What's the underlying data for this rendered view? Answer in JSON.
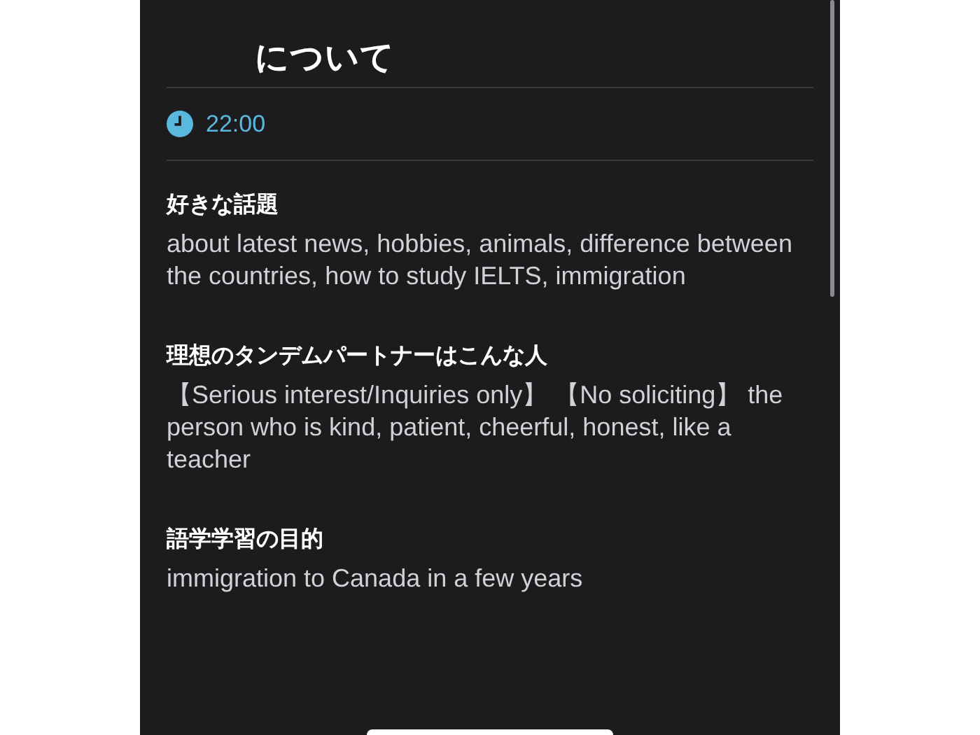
{
  "header": {
    "title": "について"
  },
  "time": "22:00",
  "sections": [
    {
      "heading": "好きな話題",
      "body": "about latest news, hobbies, animals, difference between the countries, how to study IELTS, immigration"
    },
    {
      "heading": "理想のタンデムパートナーはこんな人",
      "body": "【Serious interest/Inquiries only】 【No soliciting】 the person who is kind, patient, cheerful, honest, like a teacher"
    },
    {
      "heading": "語学学習の目的",
      "body": "immigration to Canada in a few years"
    }
  ]
}
